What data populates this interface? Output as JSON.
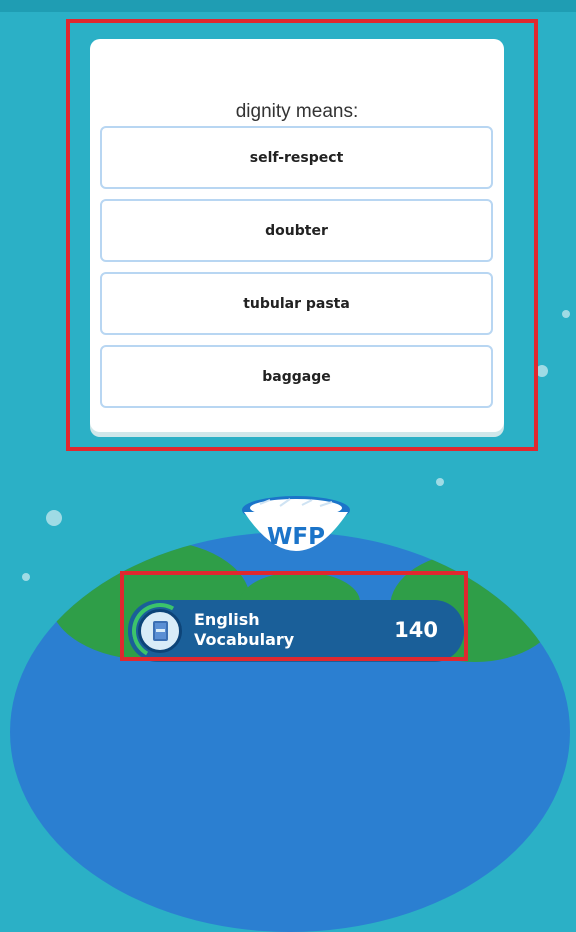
{
  "quiz": {
    "question": "dignity means:",
    "options": [
      "self-respect",
      "doubter",
      "tubular pasta",
      "baggage"
    ]
  },
  "sponsor": {
    "label": "WFP"
  },
  "category": {
    "title_line1": "English",
    "title_line2": "Vocabulary",
    "score": "140",
    "icon": "book-icon"
  },
  "colors": {
    "background": "#2bb0c6",
    "highlight": "#e0282f",
    "option_border": "#b8d6f2",
    "badge": "#1a5f99",
    "progress": "#3cc46b"
  }
}
